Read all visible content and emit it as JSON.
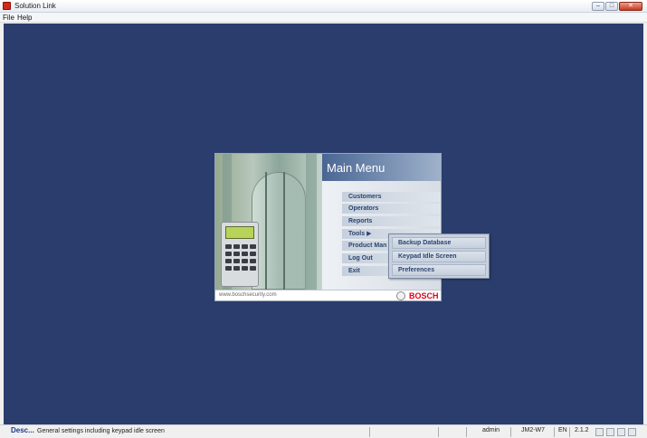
{
  "window": {
    "title": "Solution Link",
    "controls": {
      "minimize": "–",
      "maximize": "□",
      "close": "✕"
    }
  },
  "menubar": {
    "items": [
      "File",
      "Help"
    ]
  },
  "main_menu": {
    "title": "Main Menu",
    "items": [
      "Customers",
      "Operators",
      "Reports",
      "Tools ▶",
      "Product Man",
      "Log Out",
      "Exit"
    ],
    "footer_url": "www.boschsecurity.com",
    "brand": "BOSCH"
  },
  "tools_submenu": {
    "items": [
      "Backup Database",
      "Keypad Idle Screen",
      "Preferences"
    ]
  },
  "statusbar": {
    "desc_label": "Desc...",
    "description": "General settings including keypad idle screen",
    "user": "admin",
    "machine": "JM2-W7",
    "language": "EN",
    "version": "2.1.2"
  },
  "colors": {
    "desktop": "#2b3d6c",
    "header_accent": "#4a6693",
    "brand_red": "#e2001a",
    "menu_text": "#2c4470"
  }
}
